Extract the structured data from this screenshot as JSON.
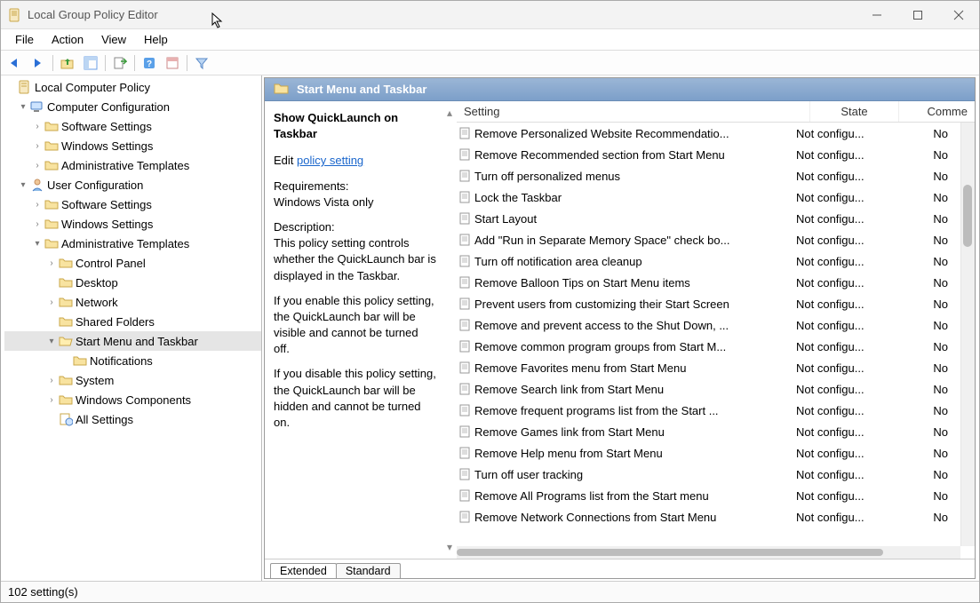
{
  "window": {
    "title": "Local Group Policy Editor"
  },
  "menubar": [
    "File",
    "Action",
    "View",
    "Help"
  ],
  "toolbar_icons": [
    "back-icon",
    "forward-icon",
    "up-icon",
    "show-hide-tree-icon",
    "export-list-icon",
    "help-icon",
    "properties-icon",
    "filter-icon"
  ],
  "tree": [
    {
      "indent": 0,
      "exp": "",
      "icon": "policy-icon",
      "label": "Local Computer Policy"
    },
    {
      "indent": 1,
      "exp": "▾",
      "icon": "computer-config-icon",
      "label": "Computer Configuration"
    },
    {
      "indent": 2,
      "exp": "›",
      "icon": "folder-icon",
      "label": "Software Settings"
    },
    {
      "indent": 2,
      "exp": "›",
      "icon": "folder-icon",
      "label": "Windows Settings"
    },
    {
      "indent": 2,
      "exp": "›",
      "icon": "folder-icon",
      "label": "Administrative Templates"
    },
    {
      "indent": 1,
      "exp": "▾",
      "icon": "user-config-icon",
      "label": "User Configuration"
    },
    {
      "indent": 2,
      "exp": "›",
      "icon": "folder-icon",
      "label": "Software Settings"
    },
    {
      "indent": 2,
      "exp": "›",
      "icon": "folder-icon",
      "label": "Windows Settings"
    },
    {
      "indent": 2,
      "exp": "▾",
      "icon": "folder-icon",
      "label": "Administrative Templates"
    },
    {
      "indent": 3,
      "exp": "›",
      "icon": "folder-icon",
      "label": "Control Panel"
    },
    {
      "indent": 3,
      "exp": "",
      "icon": "folder-icon",
      "label": "Desktop"
    },
    {
      "indent": 3,
      "exp": "›",
      "icon": "folder-icon",
      "label": "Network"
    },
    {
      "indent": 3,
      "exp": "",
      "icon": "folder-icon",
      "label": "Shared Folders"
    },
    {
      "indent": 3,
      "exp": "▾",
      "icon": "folder-open-icon",
      "label": "Start Menu and Taskbar",
      "selected": true
    },
    {
      "indent": 4,
      "exp": "",
      "icon": "folder-icon",
      "label": "Notifications"
    },
    {
      "indent": 3,
      "exp": "›",
      "icon": "folder-icon",
      "label": "System"
    },
    {
      "indent": 3,
      "exp": "›",
      "icon": "folder-icon",
      "label": "Windows Components"
    },
    {
      "indent": 3,
      "exp": "",
      "icon": "all-settings-icon",
      "label": "All Settings"
    }
  ],
  "right_header": "Start Menu and Taskbar",
  "description": {
    "selected_title": "Show QuickLaunch on Taskbar",
    "edit_prefix": "Edit ",
    "edit_link": "policy setting",
    "requirements_label": "Requirements:",
    "requirements_value": "Windows Vista only",
    "desc_label": "Description:",
    "desc_body1": "This policy setting controls whether the QuickLaunch bar is displayed in the Taskbar.",
    "desc_body2": "If you enable this policy setting, the QuickLaunch bar will be visible and cannot be turned off.",
    "desc_body3": "If you disable this policy setting, the QuickLaunch bar will be hidden and cannot be turned on."
  },
  "columns": {
    "setting": "Setting",
    "state": "State",
    "comment": "Comme"
  },
  "settings": [
    {
      "name": "Remove Personalized Website Recommendatio...",
      "state": "Not configu...",
      "comment": "No"
    },
    {
      "name": "Remove Recommended section from Start Menu",
      "state": "Not configu...",
      "comment": "No"
    },
    {
      "name": "Turn off personalized menus",
      "state": "Not configu...",
      "comment": "No"
    },
    {
      "name": "Lock the Taskbar",
      "state": "Not configu...",
      "comment": "No"
    },
    {
      "name": "Start Layout",
      "state": "Not configu...",
      "comment": "No"
    },
    {
      "name": "Add \"Run in Separate Memory Space\" check bo...",
      "state": "Not configu...",
      "comment": "No"
    },
    {
      "name": "Turn off notification area cleanup",
      "state": "Not configu...",
      "comment": "No"
    },
    {
      "name": "Remove Balloon Tips on Start Menu items",
      "state": "Not configu...",
      "comment": "No"
    },
    {
      "name": "Prevent users from customizing their Start Screen",
      "state": "Not configu...",
      "comment": "No"
    },
    {
      "name": "Remove and prevent access to the Shut Down, ...",
      "state": "Not configu...",
      "comment": "No"
    },
    {
      "name": "Remove common program groups from Start M...",
      "state": "Not configu...",
      "comment": "No"
    },
    {
      "name": "Remove Favorites menu from Start Menu",
      "state": "Not configu...",
      "comment": "No"
    },
    {
      "name": "Remove Search link from Start Menu",
      "state": "Not configu...",
      "comment": "No"
    },
    {
      "name": "Remove frequent programs list from the Start ...",
      "state": "Not configu...",
      "comment": "No"
    },
    {
      "name": "Remove Games link from Start Menu",
      "state": "Not configu...",
      "comment": "No"
    },
    {
      "name": "Remove Help menu from Start Menu",
      "state": "Not configu...",
      "comment": "No"
    },
    {
      "name": "Turn off user tracking",
      "state": "Not configu...",
      "comment": "No"
    },
    {
      "name": "Remove All Programs list from the Start menu",
      "state": "Not configu...",
      "comment": "No"
    },
    {
      "name": "Remove Network Connections from Start Menu",
      "state": "Not configu...",
      "comment": "No"
    }
  ],
  "tabs": {
    "extended": "Extended",
    "standard": "Standard"
  },
  "statusbar": {
    "text": "102 setting(s)"
  }
}
